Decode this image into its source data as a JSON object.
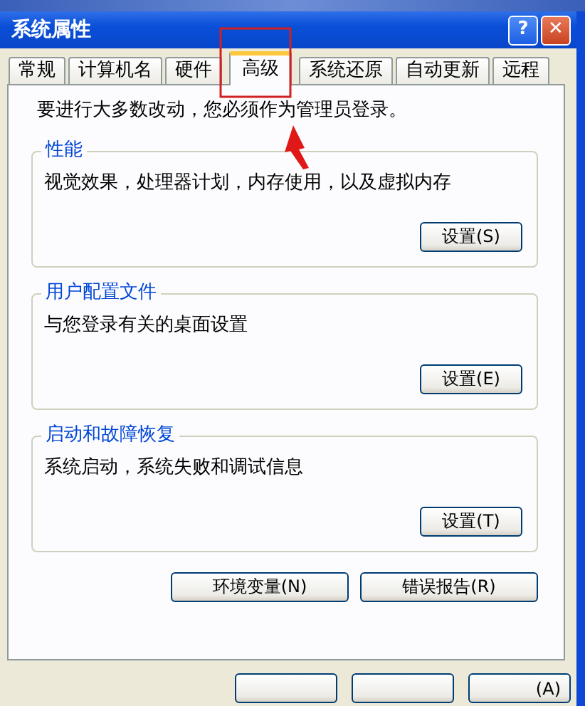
{
  "window": {
    "title": "系统属性",
    "controls": [
      {
        "kind": "help",
        "label": "?"
      },
      {
        "kind": "close",
        "label": "✕"
      }
    ]
  },
  "tabs": [
    {
      "label": "常规",
      "selected": false
    },
    {
      "label": "计算机名",
      "selected": false
    },
    {
      "label": "硬件",
      "selected": false
    },
    {
      "label": "高级",
      "selected": true
    },
    {
      "label": "系统还原",
      "selected": false
    },
    {
      "label": "自动更新",
      "selected": false
    },
    {
      "label": "远程",
      "selected": false
    }
  ],
  "notice": "要进行大多数改动，您必须作为管理员登录。",
  "groups": [
    {
      "title": "性能",
      "description": "视觉效果，处理器计划，内存使用，以及虚拟内存",
      "button": "设置(S)"
    },
    {
      "title": "用户配置文件",
      "description": "与您登录有关的桌面设置",
      "button": "设置(E)"
    },
    {
      "title": "启动和故障恢复",
      "description": "系统启动，系统失败和调试信息",
      "button": "设置(T)"
    }
  ],
  "buttons": [
    "环境变量(N)",
    "错误报告(R)"
  ],
  "dialog_buttons": [
    {
      "kind": "blank"
    },
    {
      "kind": "blank"
    },
    {
      "kind": "labeled",
      "label": "(A)"
    }
  ],
  "annotation": {
    "highlight_box": true,
    "arrow": true
  }
}
